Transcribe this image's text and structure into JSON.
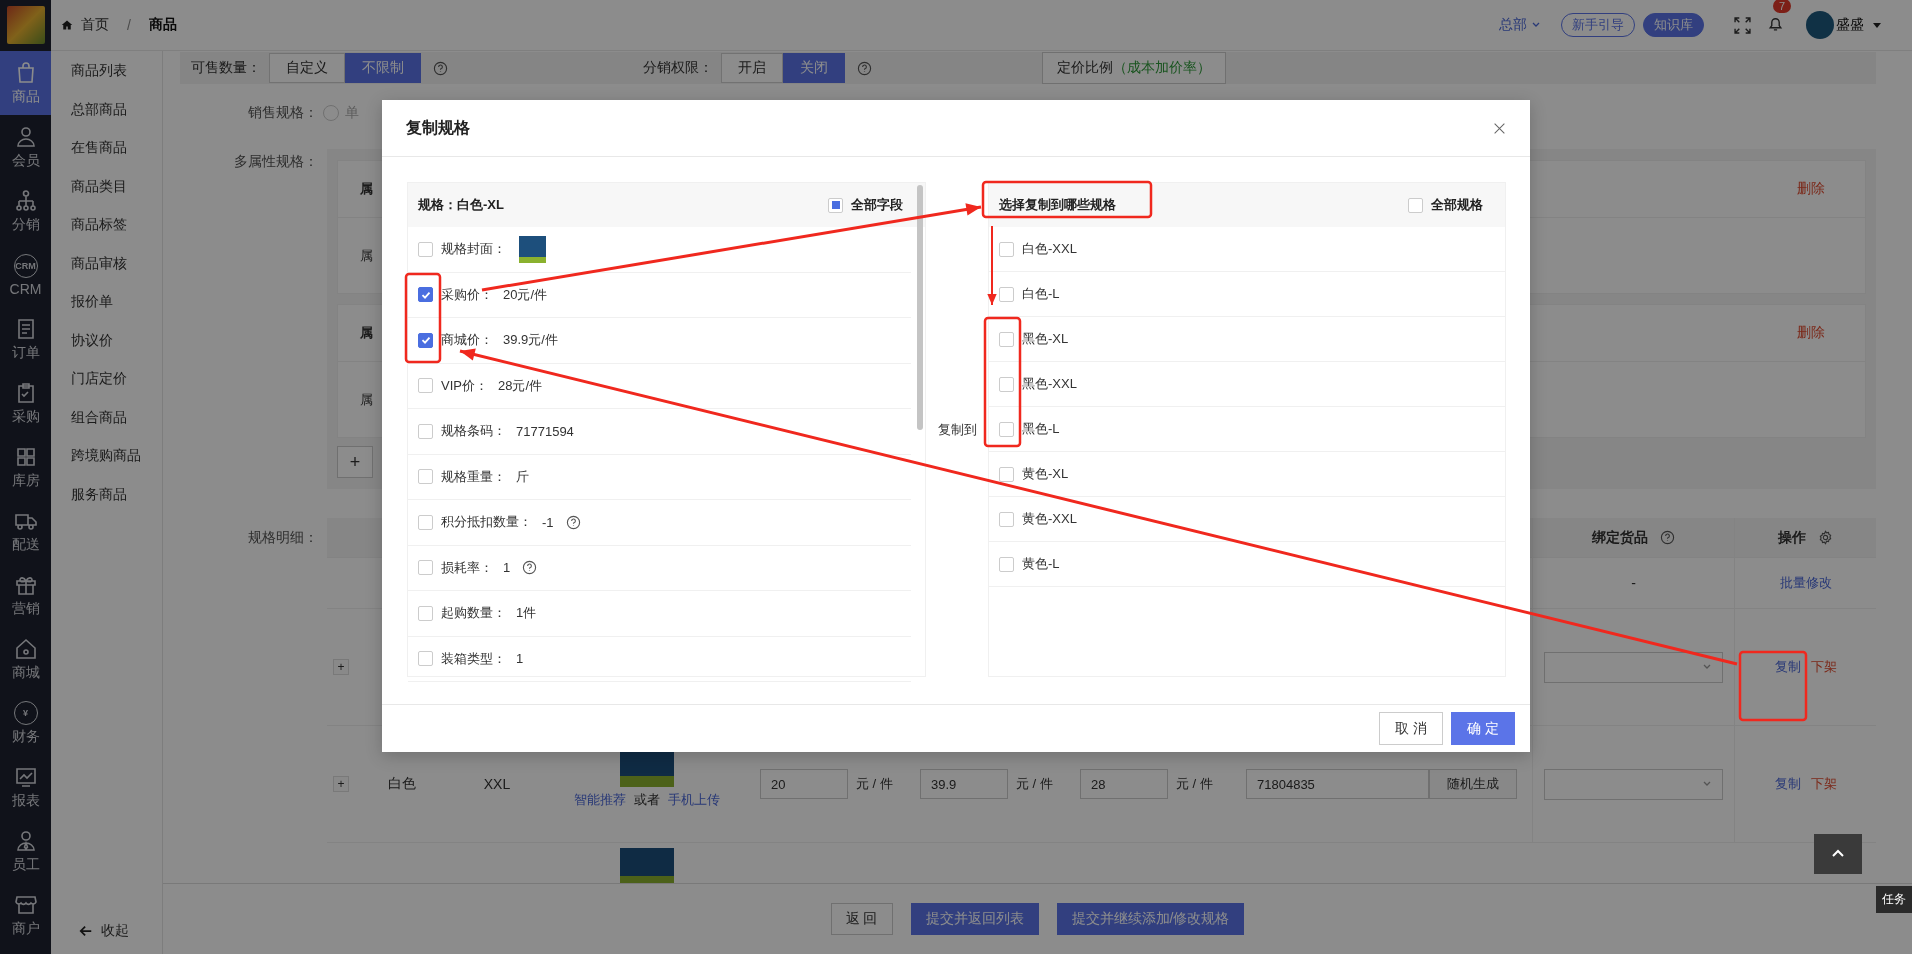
{
  "top_bar": {
    "breadcrumb": [
      "首页",
      "商品"
    ],
    "separator": "/",
    "org": "总部",
    "guide_button": "新手引导",
    "kb_button": "知识库",
    "notification_count": "7",
    "user": "盛盛"
  },
  "nav": [
    {
      "label": "商品",
      "selected": true
    },
    {
      "label": "会员",
      "selected": false
    },
    {
      "label": "分销",
      "selected": false
    },
    {
      "label": "CRM",
      "icon_text": "CRM",
      "selected": false
    },
    {
      "label": "订单",
      "selected": false
    },
    {
      "label": "采购",
      "selected": false
    },
    {
      "label": "库房",
      "selected": false
    },
    {
      "label": "配送",
      "selected": false
    },
    {
      "label": "营销",
      "selected": false
    },
    {
      "label": "商城",
      "selected": false
    },
    {
      "label": "财务",
      "icon_text": "¥",
      "selected": false
    },
    {
      "label": "报表",
      "selected": false
    },
    {
      "label": "员工",
      "selected": false
    },
    {
      "label": "商户",
      "selected": false
    }
  ],
  "submenu": {
    "items": [
      "商品列表",
      "总部商品",
      "在售商品",
      "商品类目",
      "商品标签",
      "商品审核",
      "报价单",
      "协议价",
      "门店定价",
      "组合商品",
      "跨境购商品",
      "服务商品"
    ],
    "collapse": "收起"
  },
  "form": {
    "stock": {
      "label": "可售数量：",
      "options": [
        {
          "label": "自定义",
          "selected": false
        },
        {
          "label": "不限制",
          "selected": true
        }
      ]
    },
    "distribution": {
      "label": "分销权限：",
      "options": [
        {
          "label": "开启",
          "selected": false
        },
        {
          "label": "关闭",
          "selected": true
        }
      ]
    },
    "pricing_button": {
      "label": "定价比例",
      "note": "（成本加价率）"
    },
    "sale_spec": {
      "label": "销售规格：",
      "option": "单",
      "checked": false
    },
    "multi_spec": {
      "label": "多属性规格：",
      "cards": [
        {
          "head": "属",
          "body": "属",
          "delete": "删除"
        },
        {
          "head": "属",
          "body": "属",
          "delete": "删除"
        }
      ],
      "add": "+"
    },
    "detail": {
      "label": "规格明细：",
      "columns": [
        {
          "label": "绑定货品",
          "kind": "help"
        },
        {
          "label": "操作",
          "kind": "settings"
        }
      ],
      "batch": {
        "bind": "-",
        "action": "批量修改"
      },
      "rows": [
        {
          "expand": "+",
          "actions": [
            {
              "label": "复制",
              "kind": "copy"
            },
            {
              "label": "下架",
              "kind": "remove"
            }
          ]
        },
        {
          "expand": "+",
          "color_name": "白色",
          "size": "XXL",
          "links": [
            {
              "label": "智能推荐",
              "kind": "link"
            },
            {
              "label": "或者",
              "kind": "plain"
            },
            {
              "label": "手机上传",
              "kind": "link"
            }
          ],
          "prices": [
            {
              "value": "20",
              "unit": "元 / 件"
            },
            {
              "value": "39.9",
              "unit": "元 / 件"
            },
            {
              "value": "28",
              "unit": "元 / 件"
            }
          ],
          "barcode": "71804835",
          "generate": "随机生成",
          "actions": [
            {
              "label": "复制",
              "kind": "copy"
            },
            {
              "label": "下架",
              "kind": "remove"
            }
          ]
        }
      ]
    }
  },
  "bottom_buttons": [
    {
      "label": "返 回",
      "kind": "secondary"
    },
    {
      "label": "提交并返回列表",
      "kind": "primary"
    },
    {
      "label": "提交并继续添加/修改规格",
      "kind": "primary"
    }
  ],
  "task_tab": "任务",
  "dialog": {
    "title": "复制规格",
    "source": {
      "title": "规格：白色-XL",
      "all_fields": {
        "label": "全部字段",
        "checked": false,
        "indeterminate": true
      },
      "fields": [
        {
          "label": "规格封面：",
          "kind": "image",
          "checked": false
        },
        {
          "label": "采购价：",
          "value": "20元/件",
          "kind": "text",
          "checked": true
        },
        {
          "label": "商城价：",
          "value": "39.9元/件",
          "kind": "text",
          "checked": true
        },
        {
          "label": "VIP价：",
          "value": "28元/件",
          "kind": "text",
          "checked": false
        },
        {
          "label": "规格条码：",
          "value": "71771594",
          "kind": "text",
          "checked": false
        },
        {
          "label": "规格重量：",
          "value": "斤",
          "kind": "text",
          "checked": false
        },
        {
          "label": "积分抵扣数量：",
          "value": "-1",
          "kind": "help",
          "checked": false
        },
        {
          "label": "损耗率：",
          "value": "1",
          "kind": "help",
          "checked": false
        },
        {
          "label": "起购数量：",
          "value": "1件",
          "kind": "text",
          "checked": false
        },
        {
          "label": "装箱类型：",
          "value": "1",
          "kind": "text",
          "checked": false
        }
      ]
    },
    "copy_to": "复制到",
    "target": {
      "title": "选择复制到哪些规格",
      "all": {
        "label": "全部规格",
        "checked": false
      },
      "specs": [
        {
          "label": "白色-XXL",
          "checked": false
        },
        {
          "label": "白色-L",
          "checked": false
        },
        {
          "label": "黑色-XL",
          "checked": false
        },
        {
          "label": "黑色-XXL",
          "checked": false
        },
        {
          "label": "黑色-L",
          "checked": false
        },
        {
          "label": "黄色-XL",
          "checked": false
        },
        {
          "label": "黄色-XXL",
          "checked": false
        },
        {
          "label": "黄色-L",
          "checked": false
        }
      ]
    },
    "buttons": [
      {
        "label": "取 消",
        "kind": "secondary"
      },
      {
        "label": "确 定",
        "kind": "primary"
      }
    ]
  }
}
